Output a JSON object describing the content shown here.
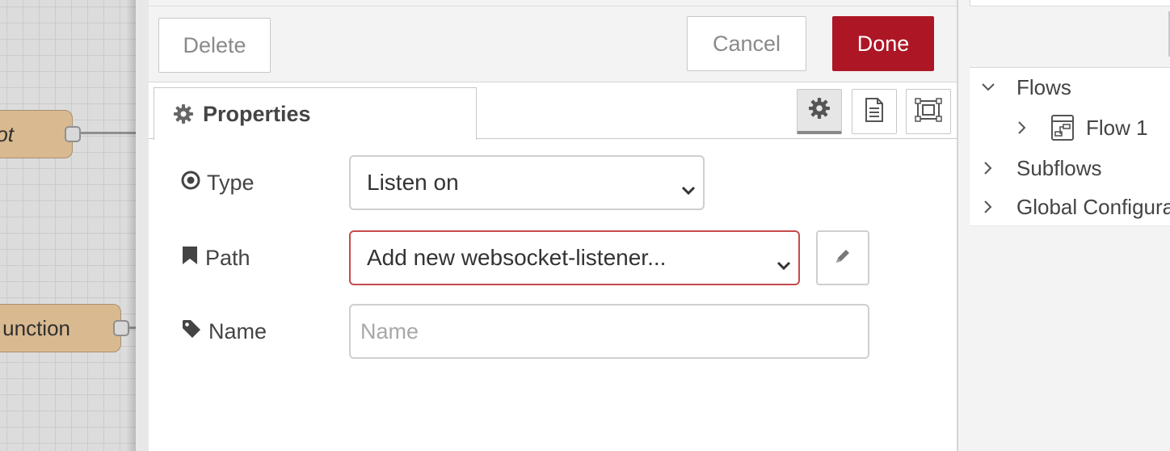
{
  "canvas": {
    "nodes": [
      {
        "label": "ot"
      },
      {
        "label": "unction"
      }
    ]
  },
  "toolbar": {
    "delete_label": "Delete",
    "cancel_label": "Cancel",
    "done_label": "Done",
    "done_color": "#ad1625"
  },
  "tabs": {
    "properties_label": "Properties",
    "properties_icon": "gear-icon",
    "icon_tabs": [
      "gear-icon",
      "document-icon",
      "frame-icon"
    ]
  },
  "form": {
    "type": {
      "label": "Type",
      "icon": "dot-circle-icon",
      "selected": "Listen on"
    },
    "path": {
      "label": "Path",
      "icon": "bookmark-icon",
      "selected": "Add new websocket-listener...",
      "edit_icon": "pencil-icon",
      "border_color": "#c74a4a"
    },
    "name": {
      "label": "Name",
      "icon": "tag-icon",
      "value": "",
      "placeholder": "Name"
    }
  },
  "sidebar": {
    "tree": {
      "flows_label": "Flows",
      "flow1_label": "Flow 1",
      "subflows_label": "Subflows",
      "global_label": "Global Configurat"
    }
  }
}
